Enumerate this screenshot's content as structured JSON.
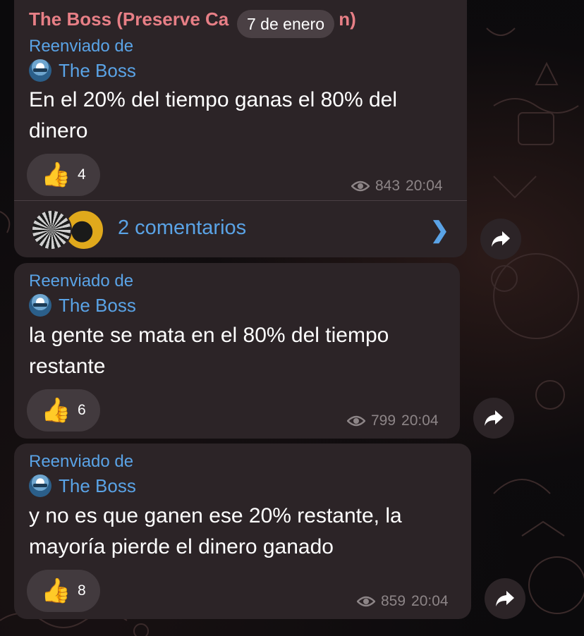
{
  "date_separator": "7 de enero",
  "channel_name": "The Boss (Preserve Ca",
  "channel_name_tail": "n)",
  "messages": [
    {
      "forwarded_label": "Reenviado de",
      "forwarded_source": "The Boss",
      "text": "En el 20% del tiempo ganas el 80% del dinero",
      "reaction_emoji": "👍",
      "reaction_count": "4",
      "views": "843",
      "time": "20:04",
      "comments_label": "2 comentarios"
    },
    {
      "forwarded_label": "Reenviado de",
      "forwarded_source": "The Boss",
      "text": "la gente se mata en el 80% del tiempo restante",
      "reaction_emoji": "👍",
      "reaction_count": "6",
      "views": "799",
      "time": "20:04"
    },
    {
      "forwarded_label": "Reenviado de",
      "forwarded_source": "The Boss",
      "text": "y no es que ganen ese 20% restante, la mayoría pierde el dinero ganado",
      "reaction_emoji": "👍",
      "reaction_count": "8",
      "views": "859",
      "time": "20:04"
    }
  ],
  "icons": {
    "views": "eye-icon",
    "share": "share-arrow-icon",
    "comments_chevron": "chevron-right-icon",
    "source_avatar": "channel-avatar",
    "reaction": "thumbs-up"
  },
  "colors": {
    "background": "#0b0a0c",
    "bubble": "#2c2427",
    "channel_name": "#e77f86",
    "link_blue": "#5aa3e6",
    "meta_gray": "#8d8587"
  }
}
